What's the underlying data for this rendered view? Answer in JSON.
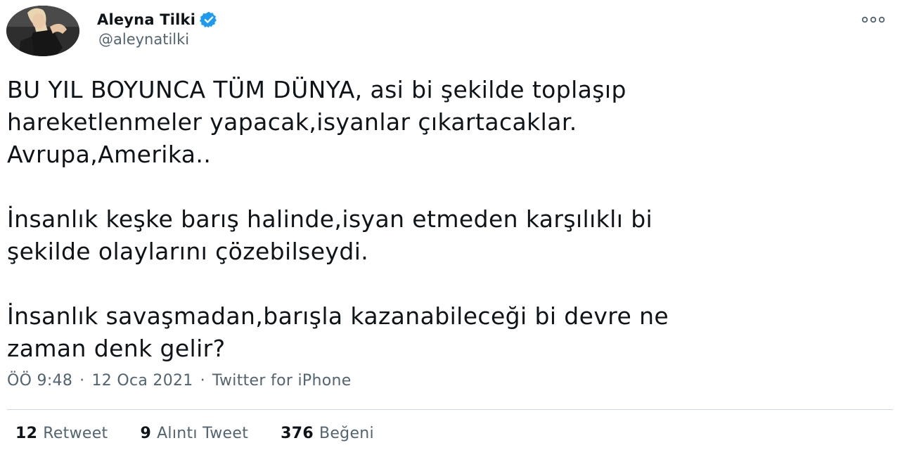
{
  "user": {
    "display_name": "Aleyna Tilki",
    "handle": "@aleynatilki",
    "verified": true,
    "avatar_icon": "profile-photo",
    "verified_color": "#1d9bf0"
  },
  "more_icon": "ellipsis-icon",
  "tweet": {
    "lines": [
      "BU YIL BOYUNCA TÜM DÜNYA, asi bi şekilde toplaşıp",
      "hareketlenmeler yapacak,isyanlar çıkartacaklar.",
      "Avrupa,Amerika..",
      "İnsanlık keşke barış halinde,isyan etmeden karşılıklı bi",
      "şekilde olaylarını çözebilseydi.",
      "İnsanlık savaşmadan,barışla kazanabileceği bi devre ne",
      "zaman denk gelir?"
    ]
  },
  "meta": {
    "time": "ÖÖ 9:48",
    "separator": "·",
    "date": "12 Oca 2021",
    "source": "Twitter for iPhone"
  },
  "stats": {
    "retweets": {
      "count": "12",
      "label": "Retweet"
    },
    "quotes": {
      "count": "9",
      "label": "Alıntı Tweet"
    },
    "likes": {
      "count": "376",
      "label": "Beğeni"
    }
  },
  "colors": {
    "text": "#0f1419",
    "secondary": "#536471",
    "divider": "#cfd9de"
  }
}
